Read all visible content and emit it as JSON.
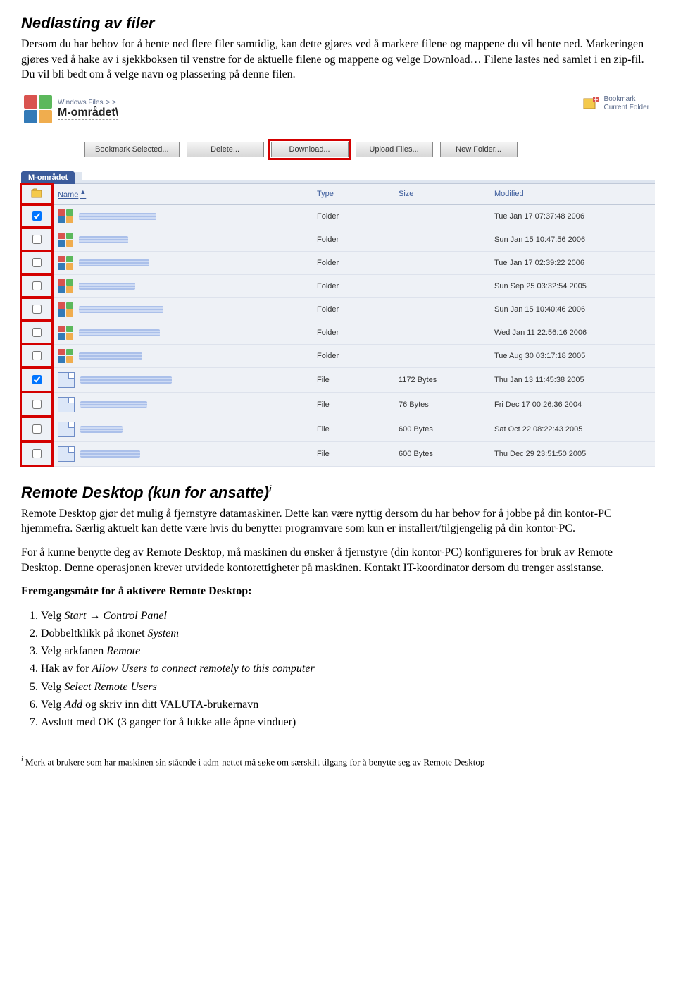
{
  "doc": {
    "heading1": "Nedlasting av filer",
    "para1": "Dersom du har behov for å hente ned flere filer samtidig, kan dette gjøres ved å markere filene og mappene du vil hente ned. Markeringen gjøres ved å hake av i sjekkboksen til venstre for de aktuelle filene og mappene og velge Download… Filene lastes ned samlet i en zip-fil. Du vil bli bedt om å velge navn og plassering på denne filen.",
    "heading2": "Remote Desktop (kun for ansatte)",
    "heading2_sup": "i",
    "para2": "Remote Desktop gjør det mulig å fjernstyre datamaskiner. Dette kan være nyttig dersom du har behov for å jobbe på din kontor-PC hjemmefra. Særlig aktuelt kan dette være hvis du benytter programvare som kun er installert/tilgjengelig på din kontor-PC.",
    "para3": "For å kunne benytte deg av Remote Desktop, må maskinen du ønsker å fjernstyre (din kontor-PC) konfigureres for bruk av Remote Desktop. Denne operasjonen krever utvidede kontorettigheter på maskinen. Kontakt IT-koordinator dersom du trenger assistanse.",
    "subhead": "Fremgangsmåte for å aktivere Remote Desktop:",
    "steps": [
      "Velg Start → Control Panel",
      "Dobbeltklikk på ikonet System",
      "Velg arkfanen Remote",
      "Hak av for Allow Users to connect remotely to this computer",
      "Velg Select Remote Users",
      "Velg Add og skriv inn ditt VALUTA-brukernavn",
      "Avslutt med OK (3 ganger for å lukke alle åpne vinduer)"
    ],
    "footnote_mark": "i",
    "footnote": " Merk at brukere som har maskinen sin stående i adm-nettet må søke om særskilt tilgang for å benytte seg av Remote Desktop"
  },
  "ui": {
    "breadcrumb_prefix": "Windows Files",
    "breadcrumb_sep": "> >",
    "breadcrumb_title": "M-området\\",
    "bookmark_line1": "Bookmark",
    "bookmark_line2": "Current Folder",
    "buttons": {
      "bookmark": "Bookmark Selected...",
      "delete": "Delete...",
      "download": "Download...",
      "upload": "Upload Files...",
      "newfolder": "New Folder..."
    },
    "tab": "M-området",
    "columns": {
      "name": "Name",
      "type": "Type",
      "size": "Size",
      "modified": "Modified"
    },
    "rows": [
      {
        "checked": true,
        "kind": "folder",
        "nameW": 110,
        "type": "Folder",
        "size": "",
        "modified": "Tue Jan 17 07:37:48 2006"
      },
      {
        "checked": false,
        "kind": "folder",
        "nameW": 70,
        "type": "Folder",
        "size": "",
        "modified": "Sun Jan 15 10:47:56 2006"
      },
      {
        "checked": false,
        "kind": "folder",
        "nameW": 100,
        "type": "Folder",
        "size": "",
        "modified": "Tue Jan 17 02:39:22 2006"
      },
      {
        "checked": false,
        "kind": "folder",
        "nameW": 80,
        "type": "Folder",
        "size": "",
        "modified": "Sun Sep 25 03:32:54 2005"
      },
      {
        "checked": false,
        "kind": "folder",
        "nameW": 120,
        "type": "Folder",
        "size": "",
        "modified": "Sun Jan 15 10:40:46 2006"
      },
      {
        "checked": false,
        "kind": "folder",
        "nameW": 115,
        "type": "Folder",
        "size": "",
        "modified": "Wed Jan 11 22:56:16 2006"
      },
      {
        "checked": false,
        "kind": "folder",
        "nameW": 90,
        "type": "Folder",
        "size": "",
        "modified": "Tue Aug 30 03:17:18 2005"
      },
      {
        "checked": true,
        "kind": "file",
        "nameW": 130,
        "type": "File",
        "size": "1172 Bytes",
        "modified": "Thu Jan 13 11:45:38 2005"
      },
      {
        "checked": false,
        "kind": "file",
        "nameW": 95,
        "type": "File",
        "size": "76 Bytes",
        "modified": "Fri Dec 17 00:26:36 2004"
      },
      {
        "checked": false,
        "kind": "file",
        "nameW": 60,
        "type": "File",
        "size": "600 Bytes",
        "modified": "Sat Oct 22 08:22:43 2005"
      },
      {
        "checked": false,
        "kind": "file",
        "nameW": 85,
        "type": "File",
        "size": "600 Bytes",
        "modified": "Thu Dec 29 23:51:50 2005"
      }
    ]
  }
}
